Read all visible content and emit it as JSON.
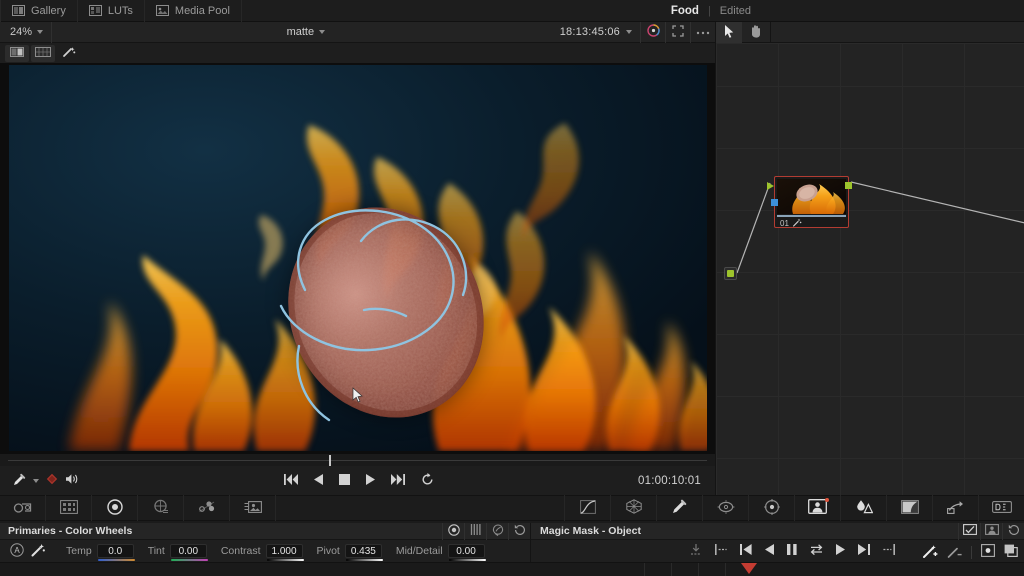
{
  "topbar": {
    "items": [
      {
        "label": "Gallery",
        "icon": "gallery-icon"
      },
      {
        "label": "LUTs",
        "icon": "luts-icon"
      },
      {
        "label": "Media Pool",
        "icon": "media-pool-icon"
      }
    ],
    "project_name": "Food",
    "divider": "|",
    "project_state": "Edited"
  },
  "viewer_header": {
    "zoom": "24%",
    "title": "matte",
    "timecode": "18:13:45:06",
    "buttons": [
      "color-wheel-icon",
      "fullscreen-icon",
      "more-options-icon"
    ]
  },
  "viewer_tools": {
    "buttons": [
      "split-screen-icon",
      "image-wipe-icon",
      "magic-wand-icon"
    ]
  },
  "transport": {
    "left_tools": [
      "eyedropper-icon",
      "node-bypass-icon",
      "audio-icon"
    ],
    "buttons": [
      "skip-to-start-icon",
      "play-reverse-icon",
      "stop-icon",
      "play-icon",
      "skip-to-end-icon",
      "loop-icon"
    ],
    "timecode": "01:00:10:01"
  },
  "palette_bar": {
    "left": [
      "camera-raw-icon",
      "color-match-icon",
      "color-wheels-icon",
      "color-warper-icon",
      "rgb-mixer-icon",
      "motion-effects-icon"
    ],
    "right": [
      "curves-icon",
      "color-warper-grid-icon",
      "qualifier-icon",
      "window-icon",
      "tracker-icon",
      "magic-mask-icon",
      "blur-icon",
      "key-icon",
      "sizing-icon",
      "stereo-3d-icon"
    ]
  },
  "primaries_panel": {
    "title": "Primaries - Color Wheels",
    "header_icons": [
      "wheels-icon",
      "bars-icon",
      "log-icon",
      "reset-icon"
    ],
    "row_icons": [
      "auto-balance-icon",
      "auto-color-icon"
    ],
    "params": [
      {
        "label": "Temp",
        "value": "0.0",
        "gradient": "g-temp"
      },
      {
        "label": "Tint",
        "value": "0.00",
        "gradient": "g-tint"
      },
      {
        "label": "Contrast",
        "value": "1.000",
        "gradient": "g-bw"
      },
      {
        "label": "Pivot",
        "value": "0.435",
        "gradient": "g-bw"
      },
      {
        "label": "Mid/Detail",
        "value": "0.00",
        "gradient": "g-bw"
      }
    ]
  },
  "magic_mask_panel": {
    "title": "Magic Mask - Object",
    "header_icons": [
      "mask-toggle-icon",
      "person-mask-icon",
      "reset-mask-icon"
    ],
    "transport": [
      "track-all-icon",
      "track-one-frame-back-icon",
      "track-reverse-start-icon",
      "track-reverse-icon",
      "pause-icon",
      "bidirectional-icon",
      "track-forward-icon",
      "track-forward-end-icon",
      "track-one-frame-forward-icon"
    ],
    "right_tools": [
      "add-stroke-icon",
      "subtract-stroke-icon",
      "mask-overlay-icon",
      "mask-copy-icon"
    ]
  },
  "node_editor": {
    "tools": [
      "select-arrow-icon",
      "pan-hand-icon"
    ],
    "nodes": [
      {
        "label": "01",
        "badge_icon": "magic-mask-badge-icon",
        "selected": true
      }
    ],
    "source_node": "source-output"
  },
  "colors": {
    "accent_red": "#b33c32",
    "port_green": "#9ec42c",
    "port_blue": "#3d90d8",
    "mask_stroke": "#8fc3e0",
    "panel_bg": "#1f1f1f",
    "graph_bg": "#232323"
  }
}
